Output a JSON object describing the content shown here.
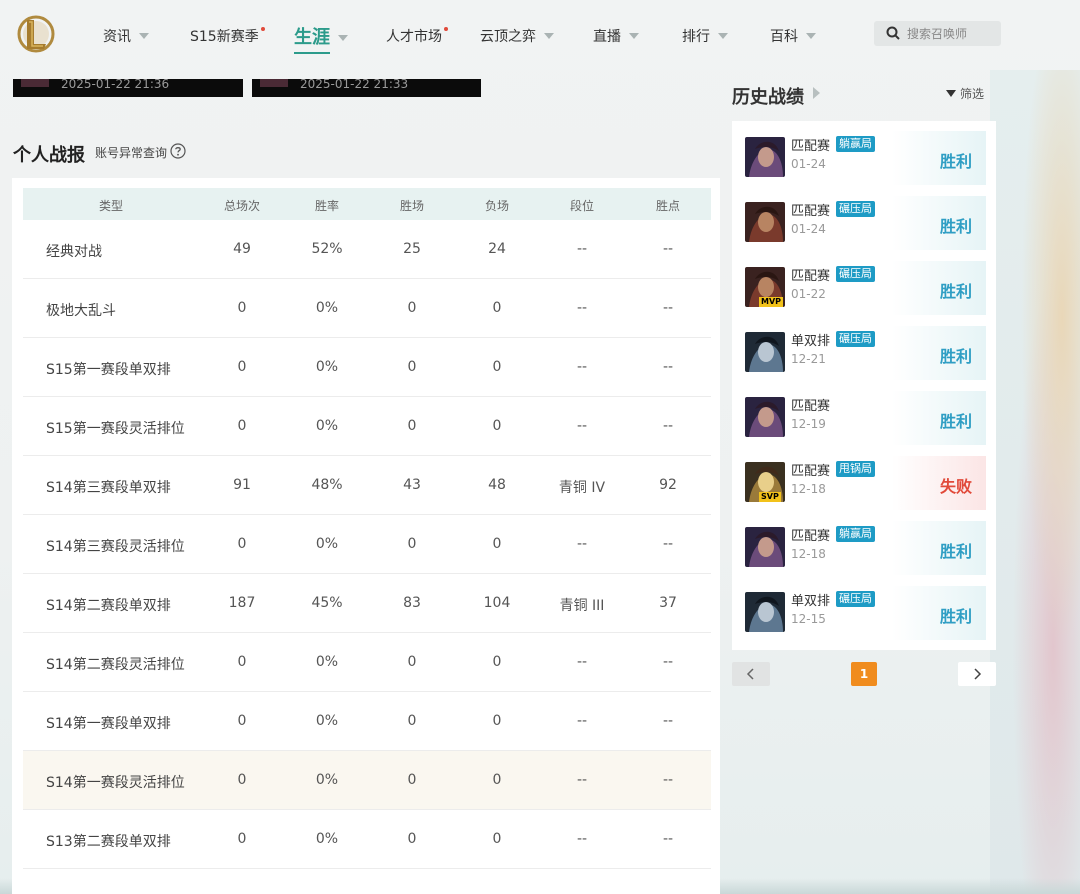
{
  "nav": {
    "items": [
      {
        "label": "资讯",
        "caret": true,
        "dot": false
      },
      {
        "label": "S15新赛季",
        "caret": false,
        "dot": true
      },
      {
        "label": "生涯",
        "caret": true,
        "dot": false,
        "active": true
      },
      {
        "label": "人才市场",
        "caret": false,
        "dot": true
      },
      {
        "label": "云顶之弈",
        "caret": true,
        "dot": false
      },
      {
        "label": "直播",
        "caret": true,
        "dot": false
      },
      {
        "label": "排行",
        "caret": true,
        "dot": false
      },
      {
        "label": "百科",
        "caret": true,
        "dot": false
      }
    ],
    "search_placeholder": "搜索召唤师"
  },
  "banners": [
    {
      "date": "2025-01-22 21:36"
    },
    {
      "date": "2025-01-22 21:33"
    }
  ],
  "stats": {
    "title": "个人战报",
    "abnormal_link": "账号异常查询",
    "columns": [
      "类型",
      "总场次",
      "胜率",
      "胜场",
      "负场",
      "段位",
      "胜点"
    ],
    "rows": [
      [
        "经典对战",
        "49",
        "52%",
        "25",
        "24",
        "--",
        "--"
      ],
      [
        "极地大乱斗",
        "0",
        "0%",
        "0",
        "0",
        "--",
        "--"
      ],
      [
        "S15第一赛段单双排",
        "0",
        "0%",
        "0",
        "0",
        "--",
        "--"
      ],
      [
        "S15第一赛段灵活排位",
        "0",
        "0%",
        "0",
        "0",
        "--",
        "--"
      ],
      [
        "S14第三赛段单双排",
        "91",
        "48%",
        "43",
        "48",
        "青铜 IV",
        "92"
      ],
      [
        "S14第三赛段灵活排位",
        "0",
        "0%",
        "0",
        "0",
        "--",
        "--"
      ],
      [
        "S14第二赛段单双排",
        "187",
        "45%",
        "83",
        "104",
        "青铜 III",
        "37"
      ],
      [
        "S14第二赛段灵活排位",
        "0",
        "0%",
        "0",
        "0",
        "--",
        "--"
      ],
      [
        "S14第一赛段单双排",
        "0",
        "0%",
        "0",
        "0",
        "--",
        "--"
      ],
      [
        "S14第一赛段灵活排位",
        "0",
        "0%",
        "0",
        "0",
        "--",
        "--"
      ],
      [
        "S13第二赛段单双排",
        "0",
        "0%",
        "0",
        "0",
        "--",
        "--"
      ]
    ]
  },
  "history": {
    "title": "历史战绩",
    "filter_label": "筛选",
    "matches": [
      {
        "mode": "匹配赛",
        "tag": "躺赢局",
        "date": "01-24",
        "result": "胜利",
        "win": true,
        "avatar": "avatar-violet",
        "badge": ""
      },
      {
        "mode": "匹配赛",
        "tag": "碾压局",
        "date": "01-24",
        "result": "胜利",
        "win": true,
        "avatar": "avatar-red",
        "badge": ""
      },
      {
        "mode": "匹配赛",
        "tag": "碾压局",
        "date": "01-22",
        "result": "胜利",
        "win": true,
        "avatar": "avatar-red",
        "badge": "MVP"
      },
      {
        "mode": "单双排",
        "tag": "碾压局",
        "date": "12-21",
        "result": "胜利",
        "win": true,
        "avatar": "avatar-steel",
        "badge": ""
      },
      {
        "mode": "匹配赛",
        "tag": "",
        "date": "12-19",
        "result": "胜利",
        "win": true,
        "avatar": "avatar-violet",
        "badge": ""
      },
      {
        "mode": "匹配赛",
        "tag": "甩锅局",
        "date": "12-18",
        "result": "失败",
        "win": false,
        "avatar": "avatar-gold",
        "badge": "SVP"
      },
      {
        "mode": "匹配赛",
        "tag": "躺赢局",
        "date": "12-18",
        "result": "胜利",
        "win": true,
        "avatar": "avatar-violet",
        "badge": ""
      },
      {
        "mode": "单双排",
        "tag": "碾压局",
        "date": "12-15",
        "result": "胜利",
        "win": true,
        "avatar": "avatar-steel",
        "badge": ""
      }
    ],
    "pagination": {
      "current": "1"
    }
  },
  "colors": {
    "accent": "#2c9b8b",
    "win": "#2f9ec4",
    "lose": "#e14a3a",
    "tag": "#1e9bc5",
    "page_current": "#f08c1e"
  }
}
